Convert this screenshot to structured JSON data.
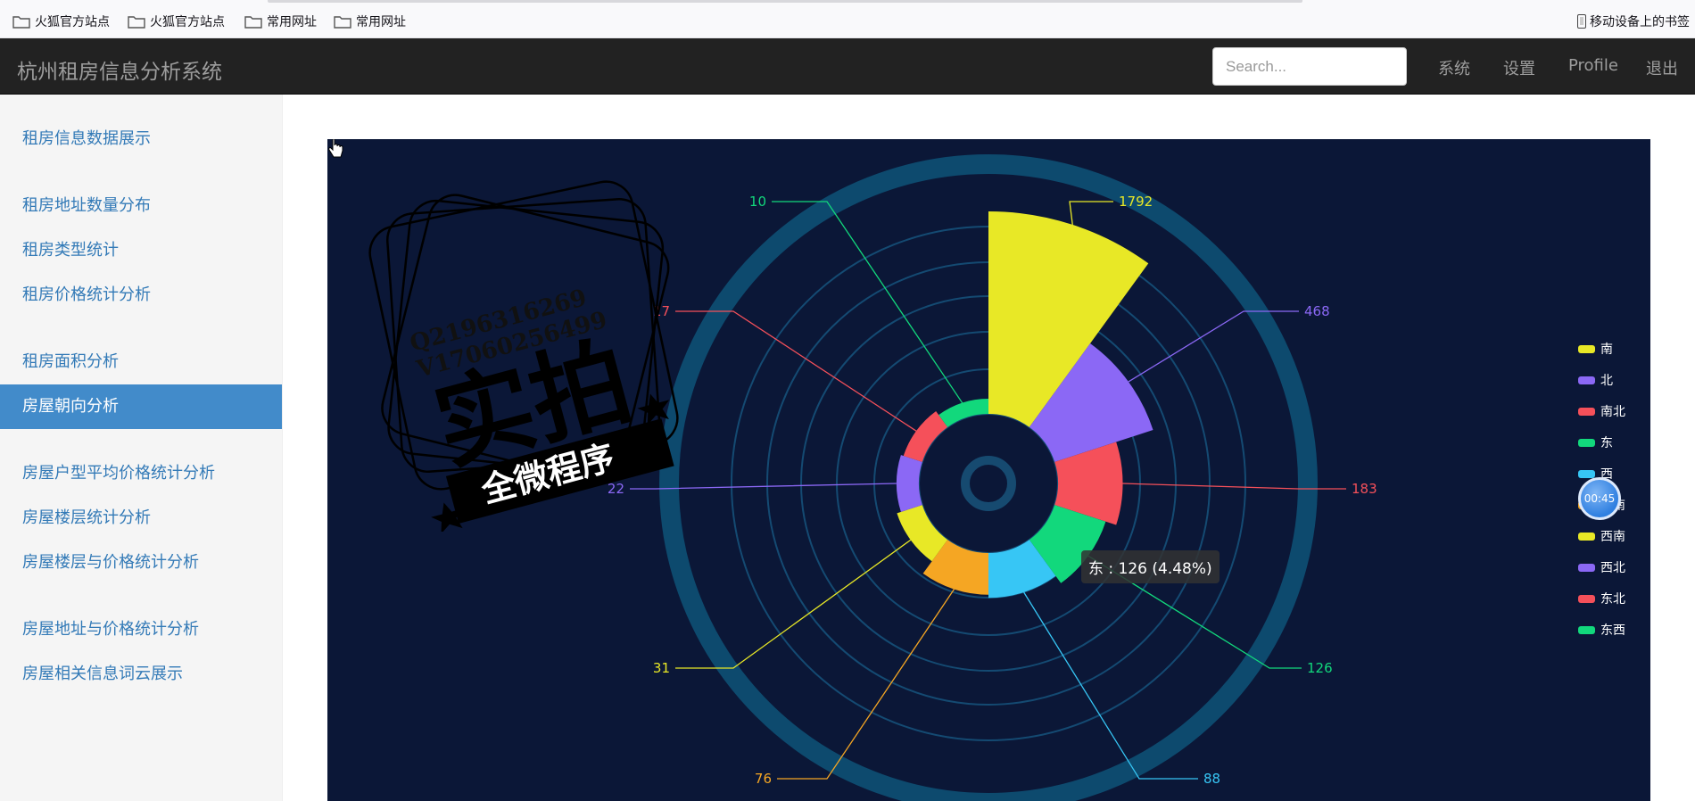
{
  "bookmarks": {
    "items": [
      {
        "label": "火狐官方站点",
        "icon": "folder-icon"
      },
      {
        "label": "火狐官方站点",
        "icon": "folder-icon"
      },
      {
        "label": "常用网址",
        "icon": "folder-icon"
      },
      {
        "label": "常用网址",
        "icon": "folder-icon"
      }
    ],
    "mobile_label": "移动设备上的书签"
  },
  "navbar": {
    "brand": "杭州租房信息分析系统",
    "search_placeholder": "Search...",
    "links": [
      "系统",
      "设置",
      "Profile",
      "退出"
    ]
  },
  "sidebar": {
    "items": [
      {
        "label": "租房信息数据展示",
        "active": false
      },
      {
        "label": "租房地址数量分布",
        "active": false
      },
      {
        "label": "租房类型统计",
        "active": false
      },
      {
        "label": "租房价格统计分析",
        "active": false
      },
      {
        "label": "租房面积分析",
        "active": false
      },
      {
        "label": "房屋朝向分析",
        "active": true
      },
      {
        "label": "房屋户型平均价格统计分析",
        "active": false
      },
      {
        "label": "房屋楼层统计分析",
        "active": false
      },
      {
        "label": "房屋楼层与价格统计分析",
        "active": false
      },
      {
        "label": "房屋地址与价格统计分析",
        "active": false
      },
      {
        "label": "房屋相关信息词云展示",
        "active": false
      }
    ]
  },
  "colors": {
    "chart_bg": "#0b1737",
    "ring": "#0d4a6e",
    "sidebar_active": "#428bca",
    "link": "#337ab7"
  },
  "chart_data": {
    "type": "pie",
    "rose_type": "area",
    "series": [
      {
        "name": "南",
        "value": 1792,
        "color": "#e8e826"
      },
      {
        "name": "北",
        "value": 468,
        "color": "#8b68f5"
      },
      {
        "name": "南北",
        "value": 183,
        "color": "#f5505a"
      },
      {
        "name": "东",
        "value": 126,
        "color": "#12d87c"
      },
      {
        "name": "西",
        "value": 88,
        "color": "#37c6f5"
      },
      {
        "name": "东南",
        "value": 76,
        "color": "#f5a623"
      },
      {
        "name": "西南",
        "value": 31,
        "color": "#e8e826"
      },
      {
        "name": "西北",
        "value": 22,
        "color": "#8b68f5"
      },
      {
        "name": "东北",
        "value": 17,
        "color": "#f5505a"
      },
      {
        "name": "东西",
        "value": 10,
        "color": "#12d87c"
      }
    ],
    "legend_position": "right",
    "legend": [
      "南",
      "北",
      "南北",
      "东",
      "西",
      "东南",
      "西南",
      "西北",
      "东北",
      "东西"
    ]
  },
  "tooltip": {
    "text": "东 : 126 (4.48%)"
  },
  "timer": {
    "text": "00:45"
  },
  "watermark": {
    "contact1": "Q2196316269",
    "contact2": "V17060256499",
    "big": "实拍",
    "small": "全微程序"
  }
}
